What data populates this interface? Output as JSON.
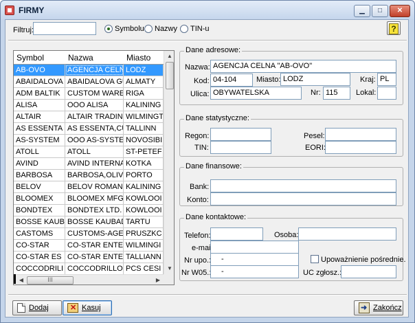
{
  "window": {
    "title": "FIRMY",
    "min": "▁",
    "max": "□",
    "close": "✕"
  },
  "filter": {
    "label": "Filtruj:",
    "value": "",
    "options": [
      "Symbolu",
      "Nazwy",
      "TIN-u"
    ],
    "selected": "Symbolu",
    "help": "?"
  },
  "grid": {
    "columns": [
      "Symbol",
      "Nazwa",
      "Miasto"
    ],
    "rows": [
      [
        "AB-OVO",
        "AGENCJA CELN",
        "LODZ"
      ],
      [
        "ABAIDALOVA",
        "ABAIDALOVA GU",
        "ALMATY"
      ],
      [
        "ADM BALTIK",
        "CUSTOM WARE",
        "RIGA"
      ],
      [
        "ALISA",
        "OOO ALISA",
        "KALINING"
      ],
      [
        "ALTAIR",
        "ALTAIR TRADIN",
        "WILMINGT"
      ],
      [
        "AS ESSENTA",
        "AS ESSENTA,CU",
        "TALLINN"
      ],
      [
        "AS-SYSTEM",
        "OOO AS-SYSTE",
        "NOVOSIBI"
      ],
      [
        "ATOLL",
        "ATOLL",
        "ST-PETEF"
      ],
      [
        "AVIND",
        "AVIND INTERNA",
        "KOTKA"
      ],
      [
        "BARBOSA",
        "BARBOSA,OLIVE",
        "PORTO"
      ],
      [
        "BELOV",
        "BELOV ROMAN",
        "KALINING"
      ],
      [
        "BLOOMEX",
        "BLOOMEX MFG.",
        "KOWLOOI"
      ],
      [
        "BONDTEX",
        "BONDTEX LTD.",
        "KOWLOOI"
      ],
      [
        "BOSSE KAUB",
        "BOSSE KAUBAD",
        "TARTU"
      ],
      [
        "CASTOMS",
        "CUSTOMS-AGE",
        "PRUSZKC"
      ],
      [
        "CO-STAR",
        "CO-STAR ENTE",
        "WILMINGI"
      ],
      [
        "CO-STAR ES",
        "CO-STAR ENTE",
        "TALLIANN"
      ],
      [
        "COCCODRILI",
        "COCCODRILLO",
        "PCS CESI"
      ]
    ],
    "selected_index": 0,
    "vscroll_up": "▲",
    "vscroll_down": "▼",
    "hscroll_left": "◀",
    "hscroll_right": "▶",
    "hscroll_grip": "III"
  },
  "address": {
    "title": "Dane adresowe:",
    "name_label": "Nazwa:",
    "name": "AGENCJA CELNA \"AB-OVO\"",
    "code_label": "Kod:",
    "code": "04-104",
    "city_label": "Miasto:",
    "city": "LODZ",
    "country_label": "Kraj:",
    "country": "PL",
    "street_label": "Ulica:",
    "street": "OBYWATELSKA",
    "number_label": "Nr:",
    "number": "115",
    "local_label": "Lokal:",
    "local": ""
  },
  "stats": {
    "title": "Dane statystyczne:",
    "regon_label": "Regon:",
    "regon": "",
    "pesel_label": "Pesel:",
    "pesel": "",
    "tin_label": "TIN:",
    "tin": "",
    "eori_label": "EORI:",
    "eori": ""
  },
  "finance": {
    "title": "Dane finansowe:",
    "bank_label": "Bank:",
    "bank": "",
    "account_label": "Konto:",
    "account": ""
  },
  "contact": {
    "title": "Dane kontaktowe:",
    "phone_label": "Telefon:",
    "phone": "",
    "person_label": "Osoba:",
    "person": "",
    "email_label": "e-mail",
    "email": "",
    "nr_upo_label": "Nr upo.:",
    "nr_upo": "-",
    "authorization_label": "Upoważnienie pośrednie.",
    "nr_w05_label": "Nr W05.:",
    "nr_w05": "-",
    "uc_label": "UC zgłosz.:",
    "uc": ""
  },
  "buttons": {
    "add": "Dodaj",
    "delete": "Kasuj",
    "exit": "Zakończ"
  }
}
